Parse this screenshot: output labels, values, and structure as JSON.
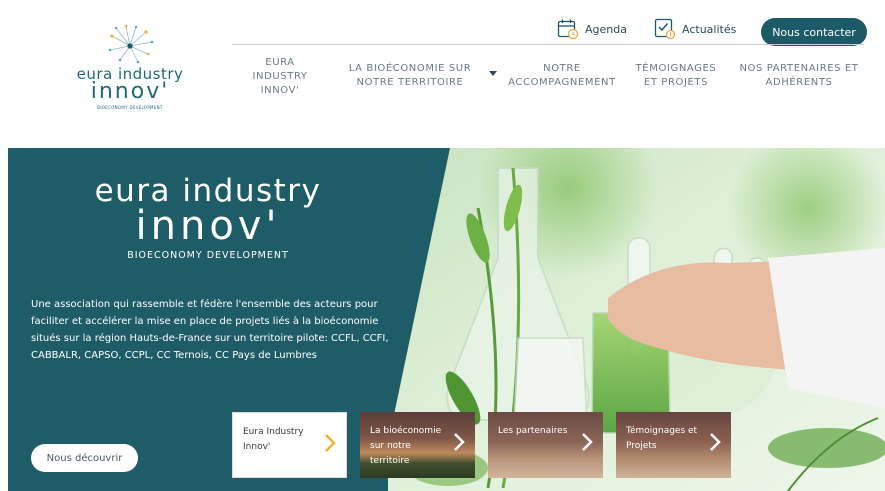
{
  "brand": {
    "line1": "eura industry",
    "line2": "innov'",
    "tagline": "BIOECONOMY DEVELOPMENT",
    "accent": "#1b5a66"
  },
  "header": {
    "utility": [
      {
        "label": "Agenda",
        "icon": "calendar-icon"
      },
      {
        "label": "Actualités",
        "icon": "checklist-icon"
      }
    ],
    "contact_label": "Nous contacter"
  },
  "nav": {
    "items": [
      {
        "label": "EURA INDUSTRY INNOV'"
      },
      {
        "label": "LA BIOÉCONOMIE SUR NOTRE TERRITOIRE",
        "has_dropdown": true
      },
      {
        "label": "NOTRE ACCOMPAGNEMENT"
      },
      {
        "label": "TÉMOIGNAGES ET PROJETS"
      },
      {
        "label": "NOS PARTENAIRES ET ADHÉRENTS"
      }
    ]
  },
  "hero": {
    "logo_line1": "eura industry",
    "logo_line2": "innov'",
    "logo_tagline": "BIOECONOMY DEVELOPMENT",
    "description": "Une association qui rassemble et fédère l'ensemble des acteurs pour faciliter et accélérer la mise en place de projets liés à la bioéconomie situés sur la région Hauts-de-France sur un territoire pilote:  CCFL, CCFI, CABBALR, CAPSO, CCPL, CC Ternois, CC Pays de Lumbres",
    "cta_label": "Nous découvrir",
    "cards": [
      {
        "label": "Eura Industry Innov'",
        "active": true
      },
      {
        "label": "La bioéconomie sur notre territoire"
      },
      {
        "label": "Les partenaires"
      },
      {
        "label": "Témoignages et Projets"
      }
    ]
  }
}
